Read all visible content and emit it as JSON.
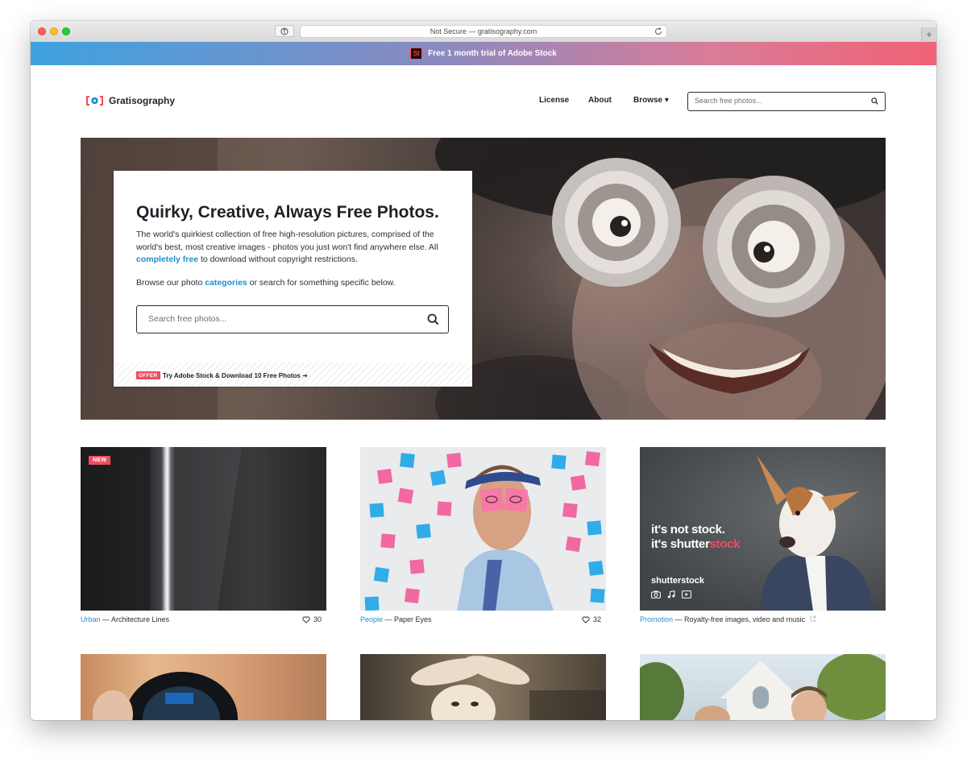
{
  "browser": {
    "url_text": "Not Secure — gratisography.com",
    "new_tab": "+"
  },
  "promo_bar": {
    "logo_text": "St",
    "text": "Free 1 month trial of Adobe Stock"
  },
  "header": {
    "logo_text": "Gratisography",
    "nav": {
      "license": "License",
      "about": "About",
      "browse": "Browse ▾"
    },
    "search_placeholder": "Search free photos..."
  },
  "hero": {
    "title": "Quirky, Creative, Always Free Photos.",
    "desc_part1": "The world's quirkiest collection of free high-resolution pictures, comprised of the world's best, most creative images - photos you just won't find anywhere else. All ",
    "desc_link": "completely free",
    "desc_part2": " to download without copyright restrictions.",
    "browse_part1": "Browse our photo ",
    "browse_link": "categories",
    "browse_part2": " or search for something specific below.",
    "search_placeholder": "Search free photos...",
    "offer_badge": "OFFER",
    "offer_text": "Try Adobe Stock & Download 10 Free Photos ➔"
  },
  "cards": [
    {
      "badge": "NEW",
      "category": "Urban",
      "title": " — Architecture Lines",
      "likes": "30"
    },
    {
      "category": "People",
      "title": " — Paper Eyes",
      "likes": "32"
    },
    {
      "category": "Promotion",
      "title": " — Royalty-free images, video and music",
      "promo_line1": "it's not stock.",
      "promo_line2a": "it's shutter",
      "promo_line2b": "stock",
      "promo_logo": "shutterstock"
    }
  ],
  "colors": {
    "accent": "#1e8fd1",
    "badge": "#ee4d60",
    "text": "#1f2227"
  }
}
